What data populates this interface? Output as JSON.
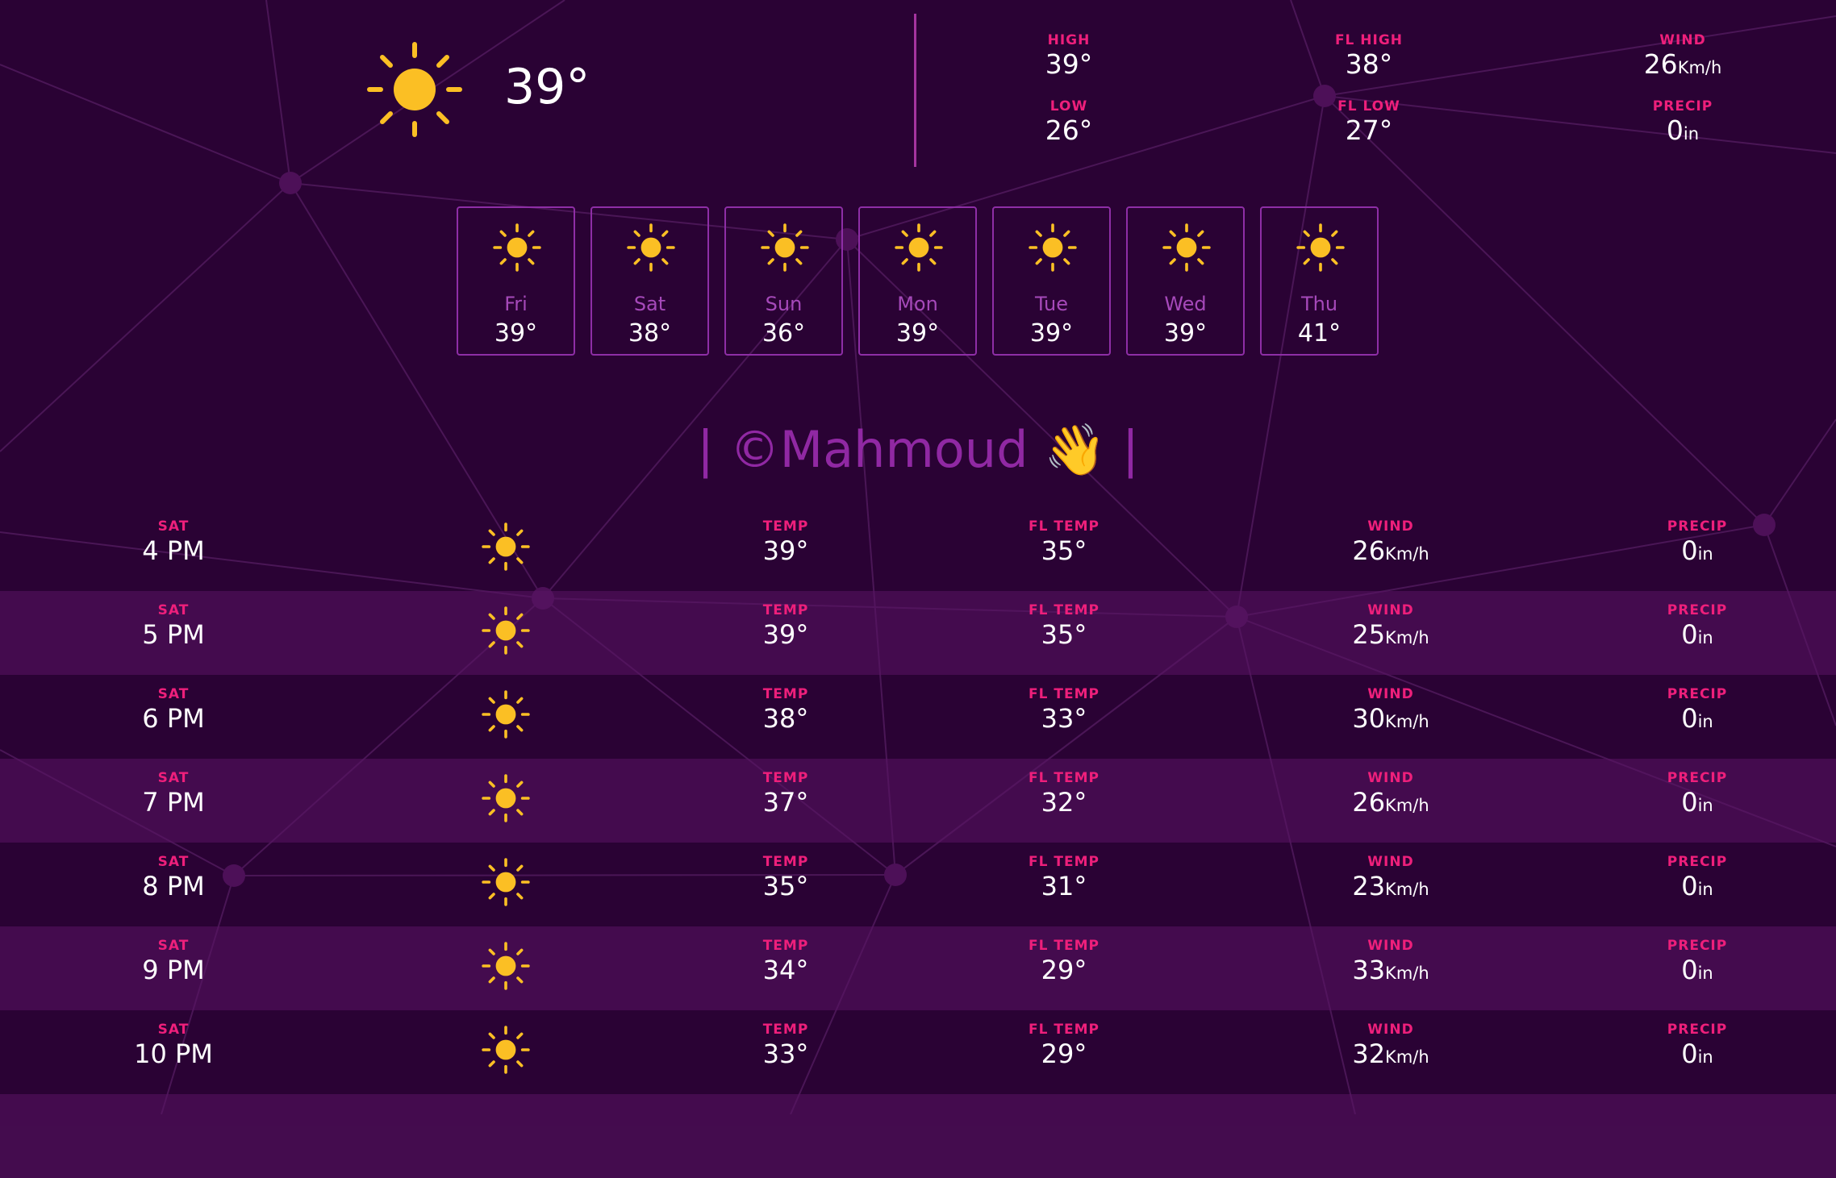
{
  "colors": {
    "background": "#2a0234",
    "accent_label": "#ee1f7b",
    "border": "#8e2ea6",
    "sun": "#fbbf24",
    "credit": "#9028a3"
  },
  "current": {
    "icon": "sun-icon",
    "temp": "39°",
    "high_label": "HIGH",
    "high": "39°",
    "low_label": "LOW",
    "low": "26°",
    "fl_high_label": "FL HIGH",
    "fl_high": "38°",
    "fl_low_label": "FL LOW",
    "fl_low": "27°",
    "wind_label": "WIND",
    "wind": "26",
    "wind_unit": "Km/h",
    "precip_label": "PRECIP",
    "precip": "0",
    "precip_unit": "in"
  },
  "week": [
    {
      "day": "Fri",
      "temp": "39°",
      "icon": "sun-icon"
    },
    {
      "day": "Sat",
      "temp": "38°",
      "icon": "sun-icon"
    },
    {
      "day": "Sun",
      "temp": "36°",
      "icon": "sun-icon"
    },
    {
      "day": "Mon",
      "temp": "39°",
      "icon": "sun-icon"
    },
    {
      "day": "Tue",
      "temp": "39°",
      "icon": "sun-icon"
    },
    {
      "day": "Wed",
      "temp": "39°",
      "icon": "sun-icon"
    },
    {
      "day": "Thu",
      "temp": "41°",
      "icon": "sun-icon"
    }
  ],
  "credit": "| ©Mahmoud 👋 |",
  "hourly_labels": {
    "temp": "TEMP",
    "fl_temp": "FL TEMP",
    "wind": "WIND",
    "precip": "PRECIP",
    "wind_unit": "Km/h",
    "precip_unit": "in"
  },
  "hourly": [
    {
      "day": "SAT",
      "time": "4 PM",
      "temp": "39°",
      "fl_temp": "35°",
      "wind": "26",
      "precip": "0",
      "icon": "sun-icon"
    },
    {
      "day": "SAT",
      "time": "5 PM",
      "temp": "39°",
      "fl_temp": "35°",
      "wind": "25",
      "precip": "0",
      "icon": "sun-icon"
    },
    {
      "day": "SAT",
      "time": "6 PM",
      "temp": "38°",
      "fl_temp": "33°",
      "wind": "30",
      "precip": "0",
      "icon": "sun-icon"
    },
    {
      "day": "SAT",
      "time": "7 PM",
      "temp": "37°",
      "fl_temp": "32°",
      "wind": "26",
      "precip": "0",
      "icon": "sun-icon"
    },
    {
      "day": "SAT",
      "time": "8 PM",
      "temp": "35°",
      "fl_temp": "31°",
      "wind": "23",
      "precip": "0",
      "icon": "sun-icon"
    },
    {
      "day": "SAT",
      "time": "9 PM",
      "temp": "34°",
      "fl_temp": "29°",
      "wind": "33",
      "precip": "0",
      "icon": "sun-icon"
    },
    {
      "day": "SAT",
      "time": "10 PM",
      "temp": "33°",
      "fl_temp": "29°",
      "wind": "32",
      "precip": "0",
      "icon": "sun-icon"
    }
  ]
}
